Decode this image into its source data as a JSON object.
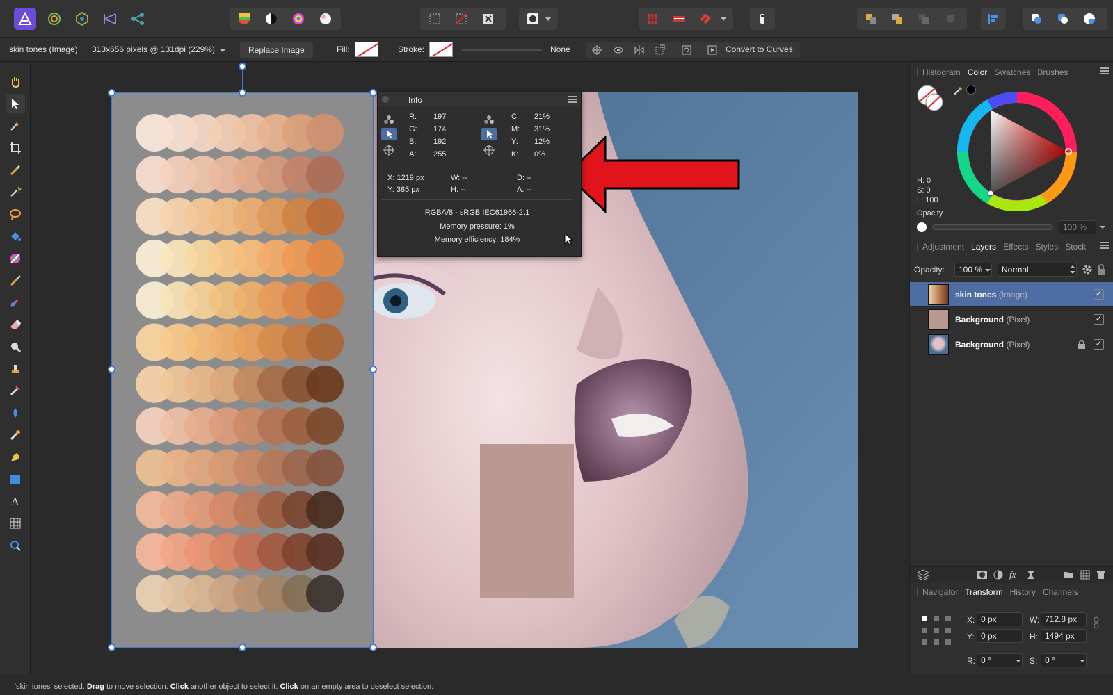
{
  "context": {
    "layer_label": "skin tones (Image)",
    "image_info": "313x656 pixels @ 131dpi (229%)",
    "replace_image": "Replace Image",
    "fill_label": "Fill:",
    "stroke_label": "Stroke:",
    "stroke_width": "None",
    "convert_curves": "Convert to Curves"
  },
  "info_panel": {
    "title": "Info",
    "rgb": [
      {
        "k": "R:",
        "v": "197"
      },
      {
        "k": "G:",
        "v": "174"
      },
      {
        "k": "B:",
        "v": "192"
      },
      {
        "k": "A:",
        "v": "255"
      }
    ],
    "cmyk": [
      {
        "k": "C:",
        "v": "21%"
      },
      {
        "k": "M:",
        "v": "31%"
      },
      {
        "k": "Y:",
        "v": "12%"
      },
      {
        "k": "K:",
        "v": "0%"
      }
    ],
    "x": "X: 1219 px",
    "y": "Y: 385 px",
    "w": "W: --",
    "h": "H: --",
    "d": "D: --",
    "a": "A: --",
    "color_profile": "RGBA/8 - sRGB IEC61966-2.1",
    "mem_pressure": "Memory pressure: 1%",
    "mem_efficiency": "Memory efficiency: 184%"
  },
  "color_tabs": [
    "Histogram",
    "Color",
    "Swatches",
    "Brushes"
  ],
  "color_panel": {
    "h": "H: 0",
    "s": "S: 0",
    "l": "L: 100",
    "opacity_label": "Opacity",
    "opacity_value": "100 %"
  },
  "layer_tabs": [
    "Adjustment",
    "Layers",
    "Effects",
    "Styles",
    "Stock"
  ],
  "layers_panel": {
    "opacity_label": "Opacity:",
    "opacity_value": "100 %",
    "blend_mode": "Normal",
    "layers": [
      {
        "name": "skin tones",
        "type": "(Image)"
      },
      {
        "name": "Background",
        "type": "(Pixel)"
      },
      {
        "name": "Background",
        "type": "(Pixel)"
      }
    ]
  },
  "bottom_tabs": [
    "Navigator",
    "Transform",
    "History",
    "Channels"
  ],
  "transform": {
    "x_label": "X:",
    "x": "0 px",
    "y_label": "Y:",
    "y": "0 px",
    "w_label": "W:",
    "w": "712.8 px",
    "h_label": "H:",
    "h": "1494 px",
    "r_label": "R:",
    "r": "0 °",
    "s_label": "S:",
    "s": "0 °"
  },
  "status": {
    "p1": "'skin tones' selected. ",
    "b1": "Drag",
    "p2": " to move selection. ",
    "b2": "Click",
    "p3": " another object to select it. ",
    "b3": "Click",
    "p4": " on an empty area to deselect selection."
  },
  "swatch_rows": [
    [
      "#fbe9dc",
      "#f8e1d2",
      "#f6d8c5",
      "#f2cdb4",
      "#efc2a3",
      "#e7b28e",
      "#dca27c",
      "#cf9170"
    ],
    [
      "#f9dfd0",
      "#f4d1bd",
      "#f0c5ad",
      "#eab99e",
      "#e3ab8c",
      "#d49a7b",
      "#c2836a",
      "#ad6e58"
    ],
    [
      "#fbe1c4",
      "#f8d4ac",
      "#f5c898",
      "#f1bd86",
      "#ebae72",
      "#e09a5b",
      "#cf8446",
      "#bd6d34"
    ],
    [
      "#fcf0d6",
      "#fbe5bb",
      "#f9d8a1",
      "#f8cb8d",
      "#f6bd7c",
      "#f3ad69",
      "#ee9b56",
      "#e48944"
    ],
    [
      "#fbf0d6",
      "#f8e3b6",
      "#f4d398",
      "#f0c27f",
      "#eeb06c",
      "#e89c59",
      "#dd884b",
      "#c9713a"
    ],
    [
      "#fbd79f",
      "#f8c98b",
      "#f4bd7a",
      "#efb06c",
      "#e8a05d",
      "#d98d4d",
      "#c47a40",
      "#ad6633"
    ],
    [
      "#f6d3a9",
      "#f0c69a",
      "#e9b88a",
      "#dda97c",
      "#c58c61",
      "#a66e46",
      "#8a5332",
      "#6e3a1e"
    ],
    [
      "#f5d1c0",
      "#f0c0a6",
      "#e8ae8f",
      "#dc9c7b",
      "#cd8b67",
      "#b47352",
      "#9d613f",
      "#7e4a2d"
    ],
    [
      "#efc295",
      "#e9b48a",
      "#e1a780",
      "#d89a73",
      "#c98a65",
      "#b57859",
      "#9d664d",
      "#86543f"
    ],
    [
      "#f2b89a",
      "#ec a98a",
      "#e39b7b",
      "#d68a69",
      "#c07859",
      "#9d5f42",
      "#7a4530",
      "#4a2c20"
    ],
    [
      "#f7b69a",
      "#f1a687",
      "#ea9676",
      "#dc8563",
      "#c47155",
      "#a35a40",
      "#7f442f",
      "#5b3224"
    ],
    [
      "#ead3b4",
      "#e3c5a3",
      "#dab693",
      "#cda683",
      "#bc9474",
      "#a48365",
      "#856f57",
      "#3d3430"
    ]
  ],
  "arrow_color": "#e0141a",
  "selection_color": "#3f7ad1",
  "accent_color": "#4d6da3"
}
